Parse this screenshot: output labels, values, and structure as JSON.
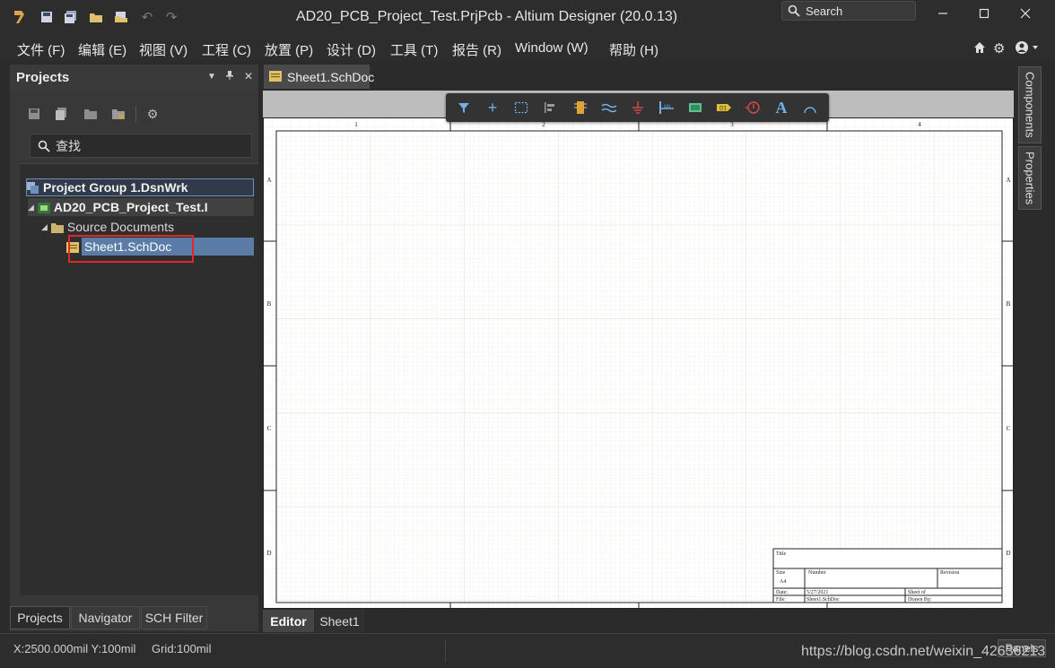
{
  "window": {
    "title": "AD20_PCB_Project_Test.PrjPcb - Altium Designer (20.0.13)",
    "search_label": "Search",
    "quick_access_icons": [
      "app-logo-icon",
      "save-icon",
      "save-all-icon",
      "open-icon",
      "open-project-icon",
      "undo-icon",
      "redo-icon"
    ]
  },
  "menu": {
    "items": [
      "文件 (F)",
      "编辑 (E)",
      "视图 (V)",
      "工程 (C)",
      "放置 (P)",
      "设计 (D)",
      "工具 (T)",
      "报告 (R)",
      "Window (W)",
      "帮助 (H)"
    ]
  },
  "projects_panel": {
    "title": "Projects",
    "search_placeholder": "查找",
    "tree": {
      "group": "Project Group 1.DsnWrk",
      "project": "AD20_PCB_Project_Test.I",
      "folder": "Source Documents",
      "document": "Sheet1.SchDoc"
    },
    "tabs": [
      "Projects",
      "Navigator",
      "SCH Filter"
    ]
  },
  "document": {
    "tab_label": "Sheet1.SchDoc",
    "editor_tabs": [
      "Editor",
      "Sheet1"
    ],
    "col_labels": [
      "1",
      "2",
      "3",
      "4"
    ],
    "row_labels": [
      "A",
      "B",
      "C",
      "D"
    ],
    "title_block": {
      "title": "Title",
      "size": "Size",
      "size_value": "A4",
      "number": "Number",
      "revision": "Revision",
      "date": "Date:",
      "date_value": "5/27/2021",
      "sheet": "Sheet   of",
      "file": "File:",
      "file_value": "Sheet1.SchDoc",
      "drawn_by": "Drawn By:"
    }
  },
  "side_tabs": [
    "Components",
    "Properties"
  ],
  "status": {
    "coords": "X:2500.000mil Y:100mil",
    "grid": "Grid:100mil",
    "panels_label": "Panels",
    "watermark": "https://blog.csdn.net/weixin_42636213"
  },
  "colors": {
    "accent_selection": "#5a7ca6",
    "highlight_box": "#e0282a",
    "grid_line": "#e4e2d8"
  }
}
